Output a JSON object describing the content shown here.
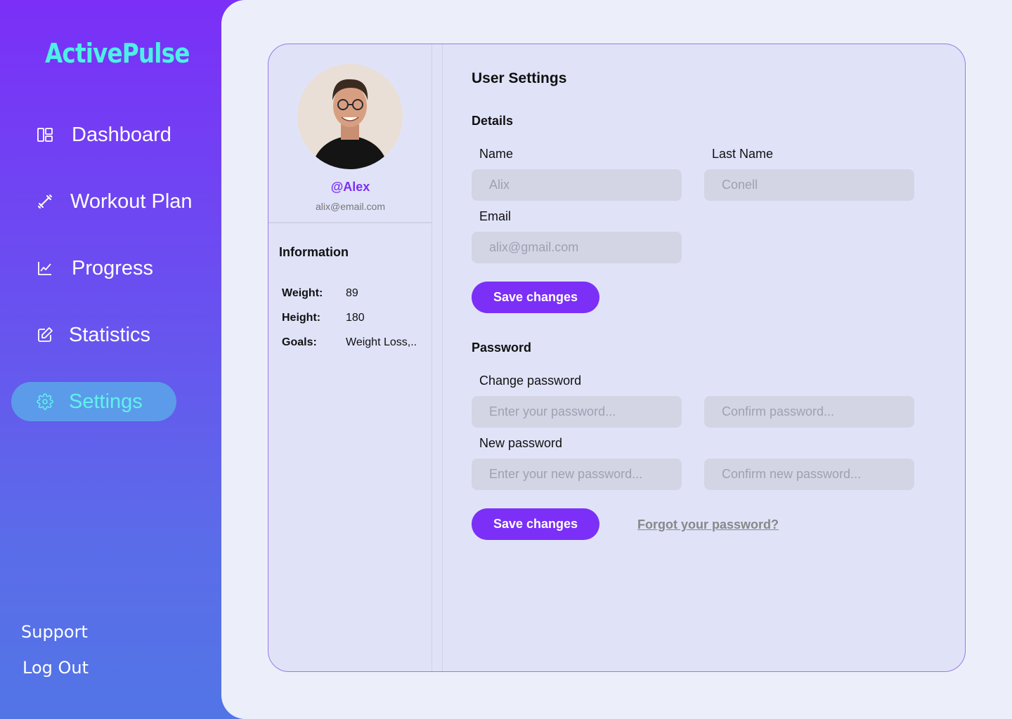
{
  "brand": {
    "name": "ActivePulse"
  },
  "sidebar": {
    "items": [
      {
        "label": "Dashboard",
        "icon": "dashboard-icon"
      },
      {
        "label": "Workout Plan",
        "icon": "dumbbell-icon"
      },
      {
        "label": "Progress",
        "icon": "chart-line-icon"
      },
      {
        "label": "Statistics",
        "icon": "edit-icon"
      },
      {
        "label": "Settings",
        "icon": "gear-icon",
        "active": true
      }
    ],
    "support": "Support",
    "logout": "Log Out"
  },
  "profile": {
    "handle": "@Alex",
    "email": "alix@email.com",
    "info_title": "Information",
    "info": [
      {
        "key": "Weight:",
        "value": "89"
      },
      {
        "key": "Height:",
        "value": "180"
      },
      {
        "key": "Goals:",
        "value": "Weight Loss,.."
      }
    ]
  },
  "settings": {
    "title": "User Settings",
    "details": {
      "title": "Details",
      "name_label": "Name",
      "name_placeholder": "Alix",
      "lastname_label": "Last Name",
      "lastname_placeholder": "Conell",
      "email_label": "Email",
      "email_placeholder": "alix@gmail.com",
      "save_label": "Save changes"
    },
    "password": {
      "title": "Password",
      "change_label": "Change password",
      "change_placeholder": "Enter your password...",
      "confirm_placeholder": "Confirm password...",
      "new_label": "New password",
      "new_placeholder": "Enter your new password...",
      "confirm_new_placeholder": "Confirm new password...",
      "save_label": "Save changes",
      "forgot_label": "Forgot your password?"
    }
  },
  "colors": {
    "accent": "#7b2ff7",
    "brand_text": "#4df0e6",
    "active_nav_bg": "#5c9be9"
  }
}
